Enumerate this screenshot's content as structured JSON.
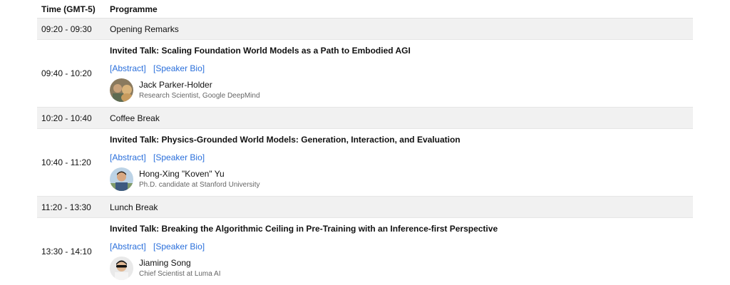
{
  "header": {
    "time_label": "Time (GMT-5)",
    "programme_label": "Programme"
  },
  "rows": [
    {
      "time": "09:20 - 09:30",
      "label": "Opening Remarks"
    },
    {
      "time": "09:40 - 10:20",
      "title": "Invited Talk: Scaling Foundation World Models as a Path to Embodied AGI",
      "abstract": "[Abstract]",
      "bio": "[Speaker Bio]",
      "speaker": "Jack Parker-Holder",
      "role": "Research Scientist, Google DeepMind"
    },
    {
      "time": "10:20 - 10:40",
      "label": "Coffee Break"
    },
    {
      "time": "10:40 - 11:20",
      "title": "Invited Talk: Physics-Grounded World Models: Generation, Interaction, and Evaluation",
      "abstract": "[Abstract]",
      "bio": "[Speaker Bio]",
      "speaker": "Hong-Xing \"Koven\" Yu",
      "role": "Ph.D. candidate at Stanford University"
    },
    {
      "time": "11:20 - 13:30",
      "label": "Lunch Break"
    },
    {
      "time": "13:30 - 14:10",
      "title": "Invited Talk: Breaking the Algorithmic Ceiling in Pre-Training with an Inference-first Perspective",
      "abstract": "[Abstract]",
      "bio": "[Speaker Bio]",
      "speaker": "Jiaming Song",
      "role": "Chief Scientist at Luma AI"
    }
  ],
  "colors": {
    "link": "#2a6fdb",
    "break_bg": "#f1f1f1",
    "secondary_text": "#666666"
  }
}
